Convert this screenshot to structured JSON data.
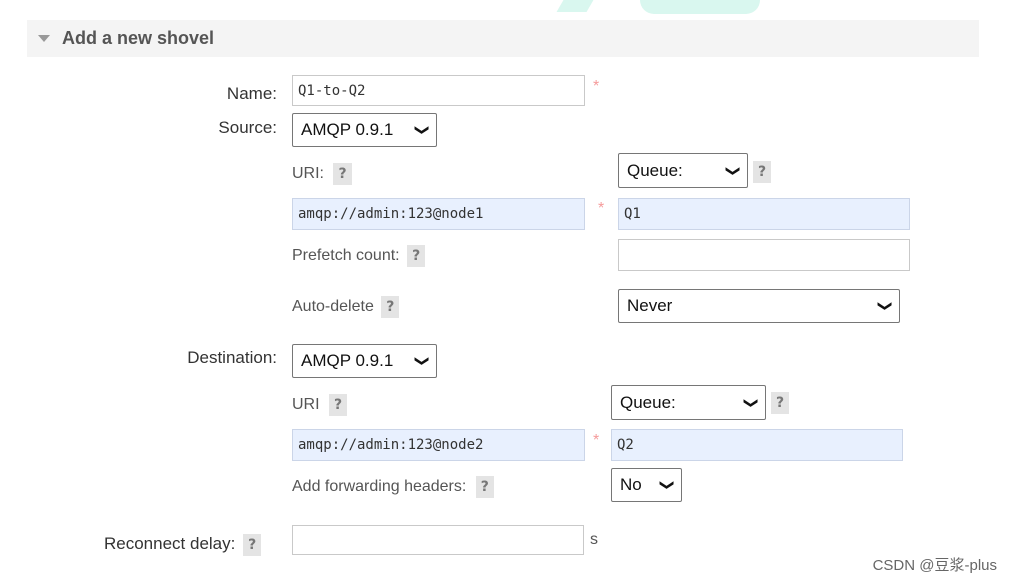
{
  "section": {
    "title": "Add a new shovel"
  },
  "name": {
    "label": "Name:",
    "value": "Q1-to-Q2",
    "required_mark": "*"
  },
  "source": {
    "label": "Source:",
    "protocol": "AMQP 0.9.1",
    "uri_label": "URI:",
    "uri_value": "amqp://admin:123@node1",
    "uri_required_mark": "*",
    "type": "Queue:",
    "queue_value": "Q1",
    "prefetch_label": "Prefetch count:",
    "prefetch_value": "",
    "autodelete_label": "Auto-delete",
    "autodelete_value": "Never"
  },
  "destination": {
    "label": "Destination:",
    "protocol": "AMQP 0.9.1",
    "uri_label": "URI",
    "uri_value": "amqp://admin:123@node2",
    "uri_required_mark": "*",
    "type": "Queue:",
    "queue_value": "Q2",
    "fwd_headers_label": "Add forwarding headers:",
    "fwd_headers_value": "No"
  },
  "reconnect": {
    "label": "Reconnect delay:",
    "value": "",
    "unit": "s"
  },
  "help_text": "?",
  "watermark": "CSDN @豆浆-plus",
  "colors": {
    "header_bg": "#f4f4f4",
    "filled_input_bg": "#e8f0fe",
    "required": "#f59a9a",
    "help_bg": "#e4e4e4"
  }
}
